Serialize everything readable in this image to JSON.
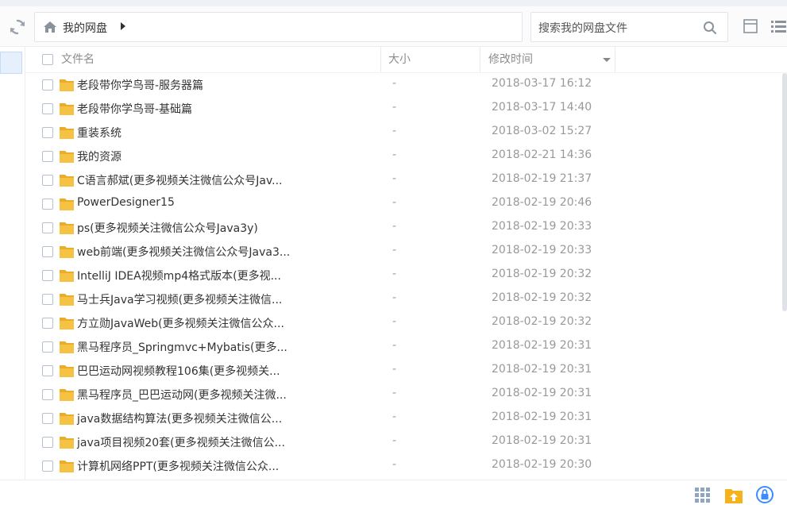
{
  "toolbar": {
    "breadcrumb": "我的网盘",
    "search_placeholder": "搜索我的网盘文件"
  },
  "columns": {
    "name": "文件名",
    "size": "大小",
    "modified": "修改时间"
  },
  "files": [
    {
      "name": "老段带你学鸟哥-服务器篇",
      "size": "-",
      "modified": "2018-03-17 16:12"
    },
    {
      "name": "老段带你学鸟哥-基础篇",
      "size": "-",
      "modified": "2018-03-17 14:40"
    },
    {
      "name": "重装系统",
      "size": "-",
      "modified": "2018-03-02 15:27"
    },
    {
      "name": "我的资源",
      "size": "-",
      "modified": "2018-02-21 14:36"
    },
    {
      "name": "C语言郝斌(更多视频关注微信公众号Jav...",
      "size": "-",
      "modified": "2018-02-19 21:37"
    },
    {
      "name": "PowerDesigner15",
      "size": "-",
      "modified": "2018-02-19 20:46"
    },
    {
      "name": "ps(更多视频关注微信公众号Java3y)",
      "size": "-",
      "modified": "2018-02-19 20:33"
    },
    {
      "name": "web前端(更多视频关注微信公众号Java3...",
      "size": "-",
      "modified": "2018-02-19 20:33"
    },
    {
      "name": "IntelliJ IDEA视频mp4格式版本(更多视...",
      "size": "-",
      "modified": "2018-02-19 20:32"
    },
    {
      "name": "马士兵Java学习视频(更多视频关注微信...",
      "size": "-",
      "modified": "2018-02-19 20:32"
    },
    {
      "name": "方立勋JavaWeb(更多视频关注微信公众...",
      "size": "-",
      "modified": "2018-02-19 20:32"
    },
    {
      "name": "黑马程序员_Springmvc+Mybatis(更多...",
      "size": "-",
      "modified": "2018-02-19 20:31"
    },
    {
      "name": "巴巴运动网视频教程106集(更多视频关...",
      "size": "-",
      "modified": "2018-02-19 20:31"
    },
    {
      "name": "黑马程序员_巴巴运动网(更多视频关注微...",
      "size": "-",
      "modified": "2018-02-19 20:31"
    },
    {
      "name": "java数据结构算法(更多视频关注微信公...",
      "size": "-",
      "modified": "2018-02-19 20:31"
    },
    {
      "name": "java项目视频20套(更多视频关注微信公...",
      "size": "-",
      "modified": "2018-02-19 20:31"
    },
    {
      "name": "计算机网络PPT(更多视频关注微信公众...",
      "size": "-",
      "modified": "2018-02-19 20:30"
    }
  ],
  "colors": {
    "folder": "#f6c244",
    "accent": "#3b8cff",
    "upload": "#f5b21c"
  }
}
